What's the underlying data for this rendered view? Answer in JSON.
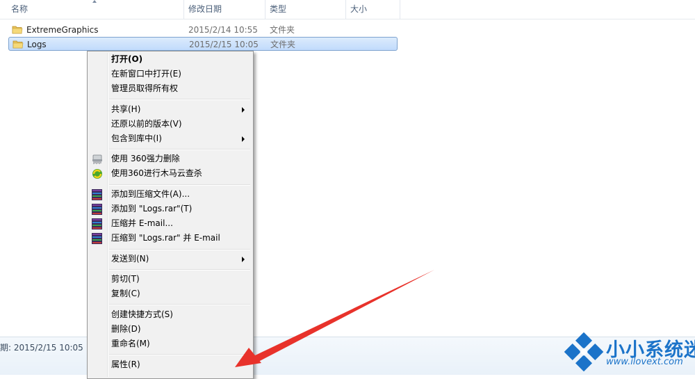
{
  "columns": {
    "name": "名称",
    "date": "修改日期",
    "type": "类型",
    "size": "大小"
  },
  "files": [
    {
      "name": "ExtremeGraphics",
      "date": "2015/2/14 10:55",
      "type": "文件夹",
      "selected": false
    },
    {
      "name": "Logs",
      "date": "2015/2/15 10:05",
      "type": "文件夹",
      "selected": true
    }
  ],
  "details": {
    "text": "期: 2015/2/15 10:05"
  },
  "context_menu": {
    "items": [
      {
        "label": "打开(O)",
        "bold": true
      },
      {
        "label": "在新窗口中打开(E)"
      },
      {
        "label": "管理员取得所有权"
      },
      {
        "label": "共享(H)",
        "submenu": true
      },
      {
        "label": "还原以前的版本(V)"
      },
      {
        "label": "包含到库中(I)",
        "submenu": true
      },
      {
        "label": "使用 360强力删除",
        "icon": "shredder-icon"
      },
      {
        "label": "使用360进行木马云查杀",
        "icon": "360-icon"
      },
      {
        "label": "添加到压缩文件(A)...",
        "icon": "winrar-icon"
      },
      {
        "label": "添加到 \"Logs.rar\"(T)",
        "icon": "winrar-icon"
      },
      {
        "label": "压缩并 E-mail...",
        "icon": "winrar-icon"
      },
      {
        "label": "压缩到 \"Logs.rar\" 并 E-mail",
        "icon": "winrar-icon"
      },
      {
        "label": "发送到(N)",
        "submenu": true
      },
      {
        "label": "剪切(T)"
      },
      {
        "label": "复制(C)"
      },
      {
        "label": "创建快捷方式(S)"
      },
      {
        "label": "删除(D)"
      },
      {
        "label": "重命名(M)"
      },
      {
        "label": "属性(R)"
      }
    ]
  },
  "watermark": {
    "title": "小小系统迷",
    "url": "www.ilovext.com"
  },
  "colors": {
    "annotation_arrow": "#e8322b",
    "watermark_blue": "#1b73c9",
    "selection": "#c1dbfc"
  }
}
